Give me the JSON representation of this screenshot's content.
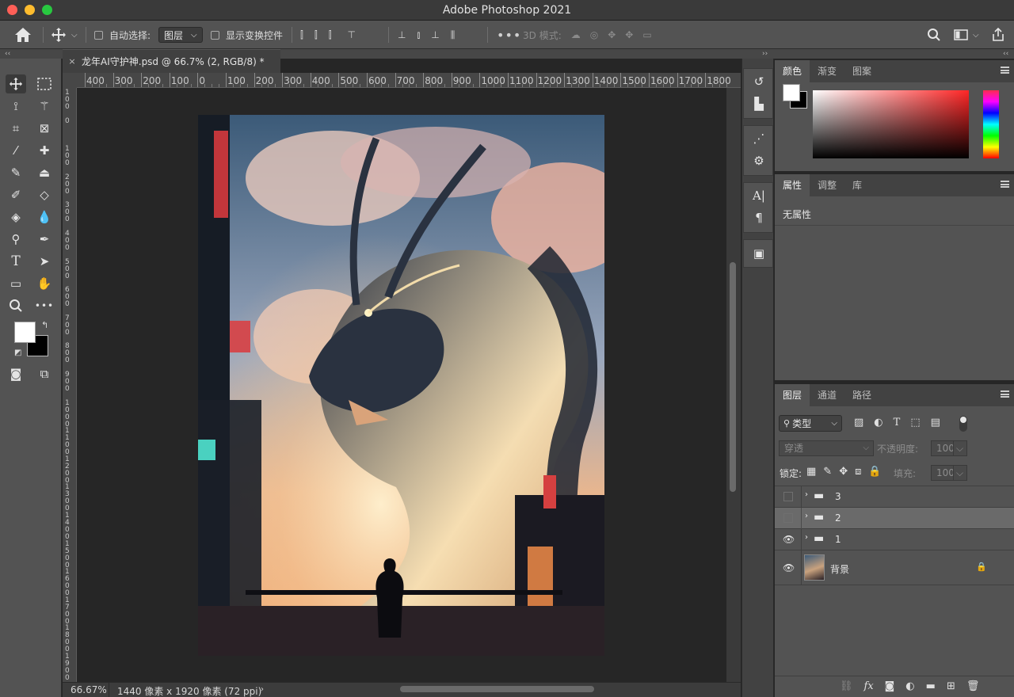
{
  "window": {
    "title": "Adobe Photoshop 2021"
  },
  "options_bar": {
    "auto_select_label": "自动选择:",
    "auto_select_value": "图层",
    "show_transform_label": "显示变换控件",
    "three_d_label": "3D 模式:"
  },
  "document": {
    "tab_title": "龙年AI守护神.psd @ 66.7% (2, RGB/8) *",
    "close_glyph": "×"
  },
  "ruler": {
    "h_ticks": [
      "400",
      "300",
      "200",
      "100",
      "0",
      "100",
      "200",
      "300",
      "400",
      "500",
      "600",
      "700",
      "800",
      "900",
      "1000",
      "1100",
      "1200",
      "1300",
      "1400",
      "1500",
      "1600",
      "1700",
      "1800"
    ],
    "v_ticks": [
      "1\n0\n0",
      "0",
      "1\n0\n0",
      "2\n0\n0",
      "3\n0\n0",
      "4\n0\n0",
      "5\n0\n0",
      "6\n0\n0",
      "7\n0\n0",
      "8\n0\n0",
      "9\n0\n0",
      "1\n0\n0\n0",
      "1\n1\n0\n0",
      "1\n2\n0\n0",
      "1\n3\n0\n0",
      "1\n4\n0\n0",
      "1\n5\n0\n0",
      "1\n6\n0\n0",
      "1\n7\n0\n0",
      "1\n8\n0\n0",
      "1\n9\n0\n0"
    ]
  },
  "status": {
    "zoom": "66.67%",
    "doc_size": "1440 像素 x 1920 像素 (72 ppi)"
  },
  "color_panel": {
    "tabs": [
      "颜色",
      "渐变",
      "图案"
    ],
    "fg_color": "#ffffff",
    "bg_color": "#000000"
  },
  "properties_panel": {
    "tabs": [
      "属性",
      "调整",
      "库"
    ],
    "empty_text": "无属性"
  },
  "layers_panel": {
    "tabs": [
      "图层",
      "通道",
      "路径"
    ],
    "filter_label": "类型",
    "blend_mode": "穿透",
    "opacity_label": "不透明度:",
    "opacity_value": "100%",
    "lock_label": "锁定:",
    "fill_label": "填充:",
    "fill_value": "100%",
    "layers": [
      {
        "name": "3",
        "visible": false,
        "type": "group",
        "selected": false
      },
      {
        "name": "2",
        "visible": false,
        "type": "group",
        "selected": true
      },
      {
        "name": "1",
        "visible": true,
        "type": "group",
        "selected": false
      },
      {
        "name": "背景",
        "visible": true,
        "type": "image",
        "locked": true,
        "selected": false
      }
    ],
    "bottom_icons": [
      "link-icon",
      "fx-icon",
      "mask-icon",
      "adjustment-icon",
      "folder-icon",
      "new-layer-icon",
      "trash-icon"
    ]
  },
  "colors": {
    "accent_red": "#ff5f57",
    "panel_bg": "#535353",
    "canvas_bg": "#262626"
  }
}
